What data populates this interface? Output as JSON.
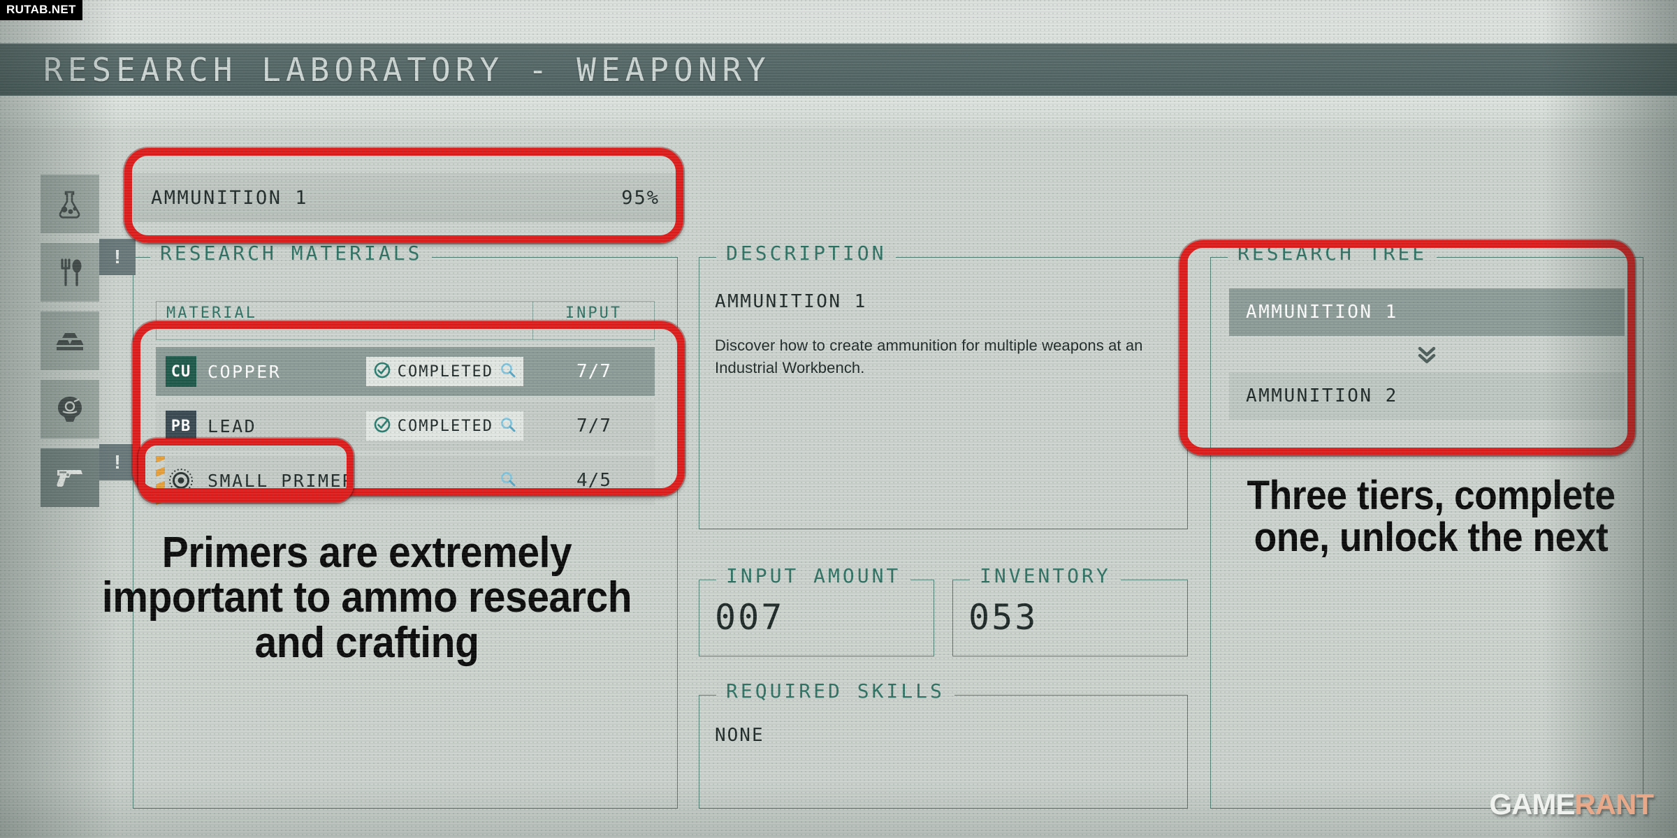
{
  "header": {
    "title": "RESEARCH LABORATORY - WEAPONRY"
  },
  "sidebar": {
    "items": [
      {
        "icon": "flask-icon",
        "name": "pharmacology",
        "selected": false,
        "badge": ""
      },
      {
        "icon": "utensils-icon",
        "name": "food",
        "selected": false,
        "badge": "!"
      },
      {
        "icon": "ingots-icon",
        "name": "manufacturing",
        "selected": false,
        "badge": ""
      },
      {
        "icon": "helmet-icon",
        "name": "outpost",
        "selected": false,
        "badge": ""
      },
      {
        "icon": "pistol-icon",
        "name": "weaponry",
        "selected": true,
        "badge": "!"
      }
    ]
  },
  "progress_header": {
    "name": "AMMUNITION 1",
    "percent": "95%"
  },
  "research_materials": {
    "legend": "RESEARCH MATERIALS",
    "columns": {
      "material": "MATERIAL",
      "input": "INPUT"
    },
    "rows": [
      {
        "symbol": "CU",
        "symbol_color": "#1d5a4b",
        "name": "COPPER",
        "status": "COMPLETED",
        "has_status": true,
        "input": "7/7",
        "selected": true,
        "striped": false
      },
      {
        "symbol": "PB",
        "symbol_color": "#3a4a52",
        "name": "LEAD",
        "status": "COMPLETED",
        "has_status": true,
        "input": "7/7",
        "selected": false,
        "striped": false
      },
      {
        "symbol": "",
        "symbol_color": "",
        "name": "SMALL PRIMER",
        "status": "",
        "has_status": false,
        "input": "4/5",
        "selected": false,
        "striped": true
      }
    ]
  },
  "description": {
    "legend": "DESCRIPTION",
    "subtitle": "AMMUNITION 1",
    "body": "Discover how to create ammunition for multiple weapons at an Industrial Workbench."
  },
  "input_amount": {
    "legend": "INPUT AMOUNT",
    "value": "007"
  },
  "inventory": {
    "legend": "INVENTORY",
    "value": "053"
  },
  "required_skills": {
    "legend": "REQUIRED SKILLS",
    "value": "NONE"
  },
  "research_tree": {
    "legend": "RESEARCH TREE",
    "nodes": [
      {
        "label": "AMMUNITION 1",
        "state": "current"
      },
      {
        "label": "AMMUNITION 2",
        "state": "next"
      }
    ]
  },
  "annotations": {
    "left": "Primers are extremely important to ammo research and crafting",
    "right": "Three tiers, complete one, unlock the next"
  },
  "watermarks": {
    "top_left": "RUTAB.NET",
    "bottom_right_part1": "GAME",
    "bottom_right_part2": "RANT"
  },
  "colors": {
    "annotation_red": "#e01b1b",
    "panel_border_teal": "#4f7d72",
    "legend_teal": "#2e7263",
    "titlebar": "#556867",
    "page_bg": "#ccd3ce",
    "selected_row": "#8e9d99",
    "primer_stripe": "#e8a13a"
  }
}
